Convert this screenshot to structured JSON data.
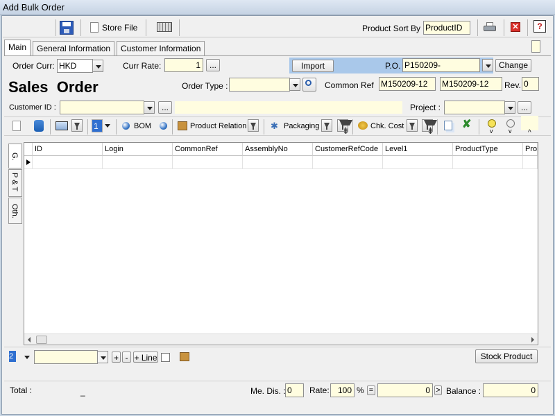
{
  "window": {
    "title": "Add Bulk Order"
  },
  "toolbar": {
    "store_file_label": "Store File",
    "product_sort_by_label": "Product Sort By",
    "product_sort_by_value": "ProductID"
  },
  "tabs": [
    "Main",
    "General Information",
    "Customer Information"
  ],
  "order": {
    "order_curr_label": "Order Curr:",
    "order_curr_value": "HKD",
    "curr_rate_label": "Curr Rate:",
    "curr_rate_value": "1",
    "ellipsis": "...",
    "import_label": "Import",
    "po_label": "P.O.",
    "po_value": "P150209-",
    "change_label": "Change",
    "heading": "Sales  Order",
    "order_type_label": "Order Type :",
    "common_ref_label": "Common Ref",
    "common_ref_value_1": "M150209-12",
    "common_ref_value_2": "M150209-12",
    "rev_label": "Rev.",
    "rev_value": "0",
    "customer_id_label": "Customer ID :",
    "project_label": "Project :"
  },
  "lines_toolbar": {
    "line_select_value": "1",
    "bom_label": "BOM",
    "product_relation_label": "Product Relation",
    "packaging_label": "Packaging",
    "chk_cost_label": "Chk. Cost",
    "bulb_v1": "v",
    "bulb_v2": "v",
    "caret": "^"
  },
  "side_tabs": [
    "G.",
    "P & T",
    "Oth."
  ],
  "grid": {
    "columns": [
      "ID",
      "Login",
      "CommonRef",
      "AssemblyNo",
      "CustomerRefCode",
      "Level1",
      "ProductType",
      "Proc"
    ]
  },
  "bottom_bar": {
    "page_value": "2",
    "plus": "+",
    "minus": "-",
    "add_line_label": "+ Line",
    "stock_product_label": "Stock Product"
  },
  "footer": {
    "total_label": "Total :",
    "total_value": "_",
    "me_dis_label": "Me. Dis. :",
    "me_dis_value": "0",
    "rate_label": "Rate:",
    "rate_value": "100",
    "percent": "%",
    "equals": "=",
    "amount_value": "0",
    "arrow": ">",
    "balance_label": "Balance :",
    "balance_value": "0"
  },
  "colors": {
    "import_bar": "#a9c8ea",
    "field_yellow": "#fffde0",
    "delete_red": "#d9302a",
    "check_green": "#2e8b2e"
  }
}
